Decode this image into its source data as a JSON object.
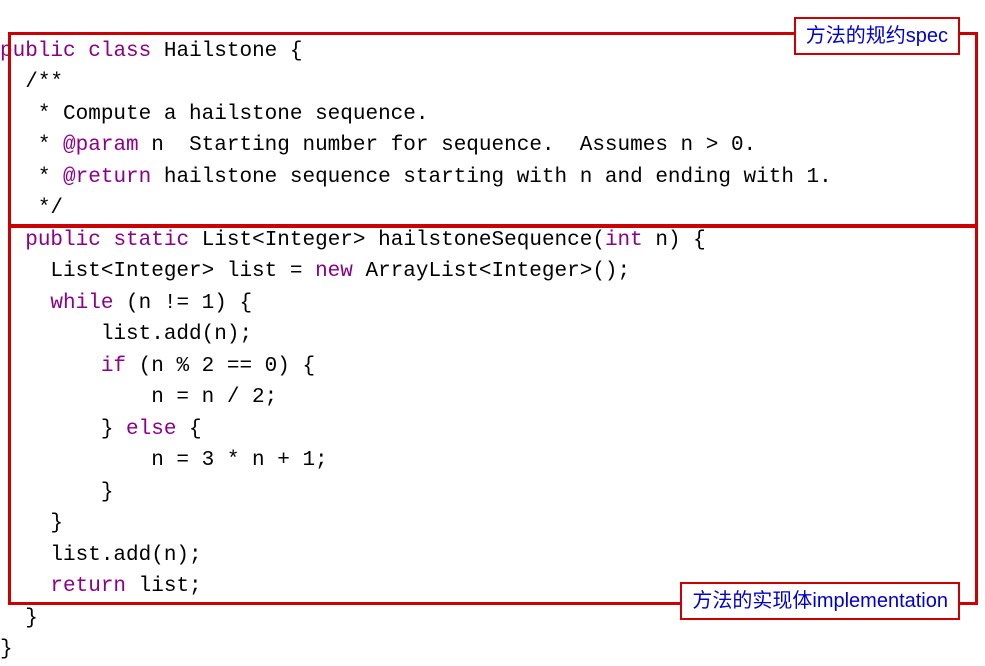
{
  "code": {
    "line1_kw1": "public",
    "line1_kw2": "class",
    "line1_name": "Hailstone {",
    "line2": "/**",
    "line3": " * Compute a hailstone sequence.",
    "line4_pre": " * ",
    "line4_tag": "@param",
    "line4_post": " n  Starting number for sequence.  Assumes n > 0.",
    "line5_pre": " * ",
    "line5_tag": "@return",
    "line5_post": " hailstone sequence starting with n and ending with 1.",
    "line6": " */",
    "line7_kw1": "public",
    "line7_kw2": "static",
    "line7_rest": "List<Integer> hailstoneSequence(",
    "line7_kw3": "int",
    "line7_rest2": " n) {",
    "line8_pre": "    List<Integer> list = ",
    "line8_kw": "new",
    "line8_post": " ArrayList<Integer>();",
    "line9_pre": "    ",
    "line9_kw": "while",
    "line9_post": " (n != 1) {",
    "line10": "        list.add(n);",
    "line11_pre": "        ",
    "line11_kw": "if",
    "line11_post": " (n % 2 == 0) {",
    "line12": "            n = n / 2;",
    "line13_pre": "        } ",
    "line13_kw": "else",
    "line13_post": " {",
    "line14": "            n = 3 * n + 1;",
    "line15": "        }",
    "line16": "    }",
    "line17": "    list.add(n);",
    "line18_pre": "    ",
    "line18_kw": "return",
    "line18_post": " list;",
    "line19": "  }",
    "line20": "}"
  },
  "labels": {
    "spec_zh": "方法的规约",
    "spec_en": "spec",
    "impl_zh": "方法的实现体",
    "impl_en": "implementation"
  }
}
